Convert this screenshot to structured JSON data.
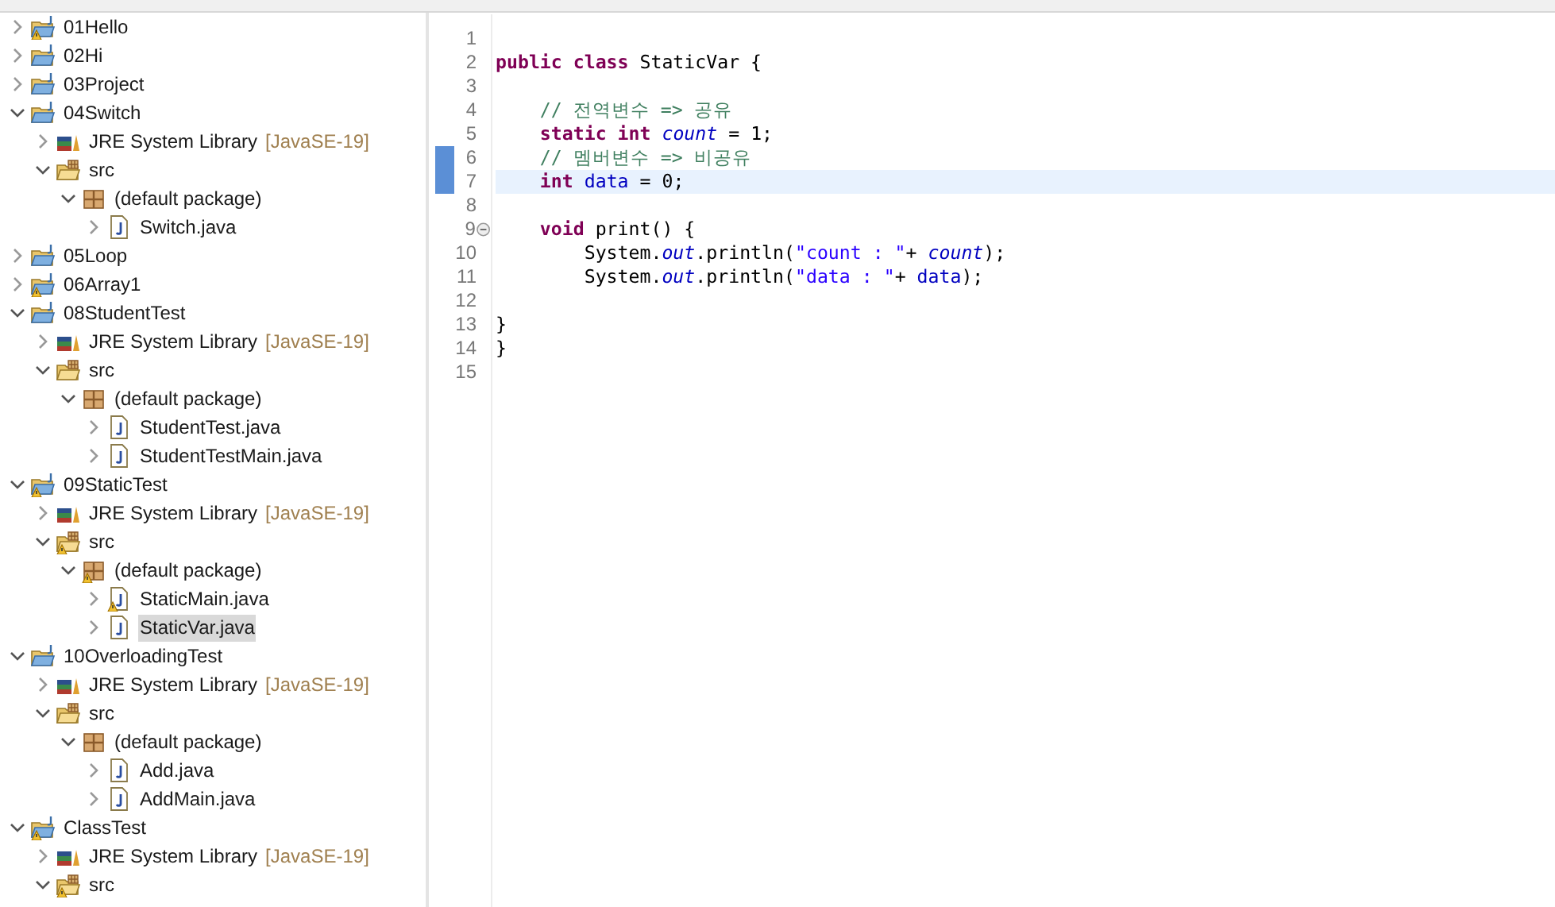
{
  "tree": [
    {
      "label": "01Hello",
      "kind": "project",
      "warning": true,
      "expanded": false,
      "selected": false
    },
    {
      "label": "02Hi",
      "kind": "project",
      "warning": false,
      "expanded": false,
      "selected": false
    },
    {
      "label": "03Project",
      "kind": "project",
      "warning": false,
      "expanded": false,
      "selected": false
    },
    {
      "label": "04Switch",
      "kind": "project",
      "warning": false,
      "expanded": true,
      "selected": false,
      "children": [
        {
          "label": "JRE System Library",
          "note": "[JavaSE-19]",
          "kind": "library",
          "warning": false,
          "expanded": false,
          "selected": false
        },
        {
          "label": "src",
          "kind": "folder",
          "warning": false,
          "expanded": true,
          "selected": false,
          "children": [
            {
              "label": "(default package)",
              "kind": "package",
              "warning": false,
              "expanded": true,
              "selected": false,
              "children": [
                {
                  "label": "Switch.java",
                  "kind": "file",
                  "warning": false,
                  "expanded": false,
                  "selected": false
                }
              ]
            }
          ]
        }
      ]
    },
    {
      "label": "05Loop",
      "kind": "project",
      "warning": false,
      "expanded": false,
      "selected": false
    },
    {
      "label": "06Array1",
      "kind": "project",
      "warning": true,
      "expanded": false,
      "selected": false
    },
    {
      "label": "08StudentTest",
      "kind": "project",
      "warning": false,
      "expanded": true,
      "selected": false,
      "children": [
        {
          "label": "JRE System Library",
          "note": "[JavaSE-19]",
          "kind": "library",
          "warning": false,
          "expanded": false,
          "selected": false
        },
        {
          "label": "src",
          "kind": "folder",
          "warning": false,
          "expanded": true,
          "selected": false,
          "children": [
            {
              "label": "(default package)",
              "kind": "package",
              "warning": false,
              "expanded": true,
              "selected": false,
              "children": [
                {
                  "label": "StudentTest.java",
                  "kind": "file",
                  "warning": false,
                  "expanded": false,
                  "selected": false
                },
                {
                  "label": "StudentTestMain.java",
                  "kind": "file",
                  "warning": false,
                  "expanded": false,
                  "selected": false
                }
              ]
            }
          ]
        }
      ]
    },
    {
      "label": "09StaticTest",
      "kind": "project",
      "warning": true,
      "expanded": true,
      "selected": false,
      "children": [
        {
          "label": "JRE System Library",
          "note": "[JavaSE-19]",
          "kind": "library",
          "warning": false,
          "expanded": false,
          "selected": false
        },
        {
          "label": "src",
          "kind": "folder",
          "warning": true,
          "expanded": true,
          "selected": false,
          "children": [
            {
              "label": "(default package)",
              "kind": "package",
              "warning": true,
              "expanded": true,
              "selected": false,
              "children": [
                {
                  "label": "StaticMain.java",
                  "kind": "file",
                  "warning": true,
                  "expanded": false,
                  "selected": false
                },
                {
                  "label": "StaticVar.java",
                  "kind": "file",
                  "warning": false,
                  "expanded": false,
                  "selected": true
                }
              ]
            }
          ]
        }
      ]
    },
    {
      "label": "10OverloadingTest",
      "kind": "project",
      "warning": false,
      "expanded": true,
      "selected": false,
      "children": [
        {
          "label": "JRE System Library",
          "note": "[JavaSE-19]",
          "kind": "library",
          "warning": false,
          "expanded": false,
          "selected": false
        },
        {
          "label": "src",
          "kind": "folder",
          "warning": false,
          "expanded": true,
          "selected": false,
          "children": [
            {
              "label": "(default package)",
              "kind": "package",
              "warning": false,
              "expanded": true,
              "selected": false,
              "children": [
                {
                  "label": "Add.java",
                  "kind": "file",
                  "warning": false,
                  "expanded": false,
                  "selected": false
                },
                {
                  "label": "AddMain.java",
                  "kind": "file",
                  "warning": false,
                  "expanded": false,
                  "selected": false
                }
              ]
            }
          ]
        }
      ]
    },
    {
      "label": "ClassTest",
      "kind": "project",
      "warning": true,
      "expanded": true,
      "selected": false,
      "children": [
        {
          "label": "JRE System Library",
          "note": "[JavaSE-19]",
          "kind": "library",
          "warning": false,
          "expanded": false,
          "selected": false
        },
        {
          "label": "src",
          "kind": "folder",
          "warning": true,
          "expanded": true,
          "selected": false
        }
      ]
    }
  ],
  "editor": {
    "lines": [
      {
        "number": "1",
        "current": false,
        "changed": false
      },
      {
        "number": "2",
        "current": false,
        "changed": false,
        "tokens": [
          {
            "text": "public class",
            "kind": "keyword"
          },
          {
            "text": " StaticVar {",
            "kind": "plain"
          }
        ]
      },
      {
        "number": "3",
        "current": false,
        "changed": false
      },
      {
        "number": "4",
        "current": false,
        "changed": false,
        "tokens": [
          {
            "text": "    // 전역변수 => 공유",
            "kind": "comment"
          }
        ]
      },
      {
        "number": "5",
        "current": false,
        "changed": false,
        "tokens": [
          {
            "text": "    static int",
            "kind": "keyword"
          },
          {
            "text": " count",
            "kind": "static"
          },
          {
            "text": " = 1;",
            "kind": "plain"
          }
        ]
      },
      {
        "number": "6",
        "current": false,
        "changed": true,
        "tokens": [
          {
            "text": "    // 멤버변수 => 비공유",
            "kind": "comment"
          }
        ]
      },
      {
        "number": "7",
        "current": true,
        "changed": true,
        "tokens": [
          {
            "text": "    int",
            "kind": "keyword"
          },
          {
            "text": " data",
            "kind": "field"
          },
          {
            "text": " = 0;",
            "kind": "plain"
          }
        ]
      },
      {
        "number": "8",
        "current": false,
        "changed": false
      },
      {
        "number": "9",
        "current": false,
        "changed": false,
        "fold": true,
        "tokens": [
          {
            "text": "    void",
            "kind": "keyword"
          },
          {
            "text": " print() {",
            "kind": "plain"
          }
        ]
      },
      {
        "number": "10",
        "current": false,
        "changed": false,
        "tokens": [
          {
            "text": "        System.",
            "kind": "plain"
          },
          {
            "text": "out",
            "kind": "static"
          },
          {
            "text": ".println(",
            "kind": "plain"
          },
          {
            "text": "\"count : \"",
            "kind": "string"
          },
          {
            "text": "+ ",
            "kind": "plain"
          },
          {
            "text": "count",
            "kind": "static"
          },
          {
            "text": ");",
            "kind": "plain"
          }
        ]
      },
      {
        "number": "11",
        "current": false,
        "changed": false,
        "tokens": [
          {
            "text": "        System.",
            "kind": "plain"
          },
          {
            "text": "out",
            "kind": "static"
          },
          {
            "text": ".println(",
            "kind": "plain"
          },
          {
            "text": "\"data : \"",
            "kind": "string"
          },
          {
            "text": "+ ",
            "kind": "plain"
          },
          {
            "text": "data",
            "kind": "field"
          },
          {
            "text": ");",
            "kind": "plain"
          }
        ]
      },
      {
        "number": "12",
        "current": false,
        "changed": false
      },
      {
        "number": "13",
        "current": false,
        "changed": false,
        "tokens": [
          {
            "text": "}",
            "kind": "plain"
          }
        ]
      },
      {
        "number": "14",
        "current": false,
        "changed": false,
        "tokens": [
          {
            "text": "}",
            "kind": "plain"
          }
        ]
      },
      {
        "number": "15",
        "current": false,
        "changed": false
      }
    ]
  }
}
